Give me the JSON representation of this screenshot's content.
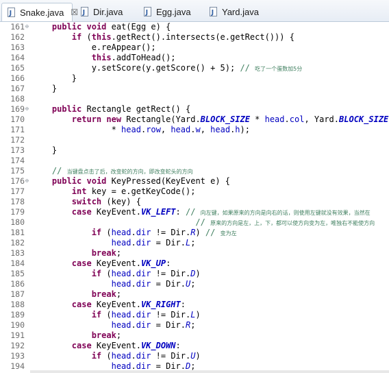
{
  "tabs": [
    {
      "label": "Snake.java",
      "active": true,
      "close": "☒"
    },
    {
      "label": "Dir.java",
      "active": false
    },
    {
      "label": "Egg.java",
      "active": false
    },
    {
      "label": "Yard.java",
      "active": false
    }
  ],
  "colors": {
    "keyword": "#7f0055",
    "comment": "#3f7f5f",
    "field": "#0000c0",
    "line_number": "#6d6d6d"
  },
  "lines": [
    {
      "n": "161",
      "fold": "⊖",
      "tokens": [
        [
          "",
          "    "
        ],
        [
          "kw",
          "public"
        ],
        [
          "",
          " "
        ],
        [
          "kw",
          "void"
        ],
        [
          "",
          " eat(Egg e) {"
        ]
      ]
    },
    {
      "n": "162",
      "tokens": [
        [
          "",
          "        "
        ],
        [
          "kw",
          "if"
        ],
        [
          "",
          " ("
        ],
        [
          "kw",
          "this"
        ],
        [
          "",
          ".getRect().intersects(e.getRect())) {"
        ]
      ]
    },
    {
      "n": "163",
      "tokens": [
        [
          "",
          "            e.reAppear();"
        ]
      ]
    },
    {
      "n": "164",
      "tokens": [
        [
          "",
          "            "
        ],
        [
          "kw",
          "this"
        ],
        [
          "",
          ".addToHead();"
        ]
      ]
    },
    {
      "n": "165",
      "tokens": [
        [
          "",
          "            y.setScore(y.getScore() + 5); "
        ],
        [
          "cm",
          "// "
        ],
        [
          "cms",
          "吃了一个蛋数加5分"
        ]
      ]
    },
    {
      "n": "166",
      "tokens": [
        [
          "",
          "        }"
        ]
      ]
    },
    {
      "n": "167",
      "tokens": [
        [
          "",
          "    }"
        ]
      ]
    },
    {
      "n": "168",
      "tokens": [
        [
          "",
          ""
        ]
      ]
    },
    {
      "n": "169",
      "fold": "⊖",
      "tokens": [
        [
          "",
          "    "
        ],
        [
          "kw",
          "public"
        ],
        [
          "",
          " Rectangle getRect() {"
        ]
      ]
    },
    {
      "n": "170",
      "tokens": [
        [
          "",
          "        "
        ],
        [
          "kw",
          "return"
        ],
        [
          "",
          " "
        ],
        [
          "kw",
          "new"
        ],
        [
          "",
          " Rectangle(Yard."
        ],
        [
          "sfld",
          "BLOCK_SIZE"
        ],
        [
          "",
          " * "
        ],
        [
          "fld",
          "head"
        ],
        [
          "",
          "."
        ],
        [
          "fld",
          "col"
        ],
        [
          "",
          ", Yard."
        ],
        [
          "sfld",
          "BLOCK_SIZE"
        ]
      ]
    },
    {
      "n": "171",
      "tokens": [
        [
          "",
          "                * "
        ],
        [
          "fld",
          "head"
        ],
        [
          "",
          "."
        ],
        [
          "fld",
          "row"
        ],
        [
          "",
          ", "
        ],
        [
          "fld",
          "head"
        ],
        [
          "",
          "."
        ],
        [
          "fld",
          "w"
        ],
        [
          "",
          ", "
        ],
        [
          "fld",
          "head"
        ],
        [
          "",
          "."
        ],
        [
          "fld",
          "h"
        ],
        [
          "",
          ");"
        ]
      ]
    },
    {
      "n": "172",
      "tokens": [
        [
          "",
          ""
        ]
      ]
    },
    {
      "n": "173",
      "tokens": [
        [
          "",
          "    }"
        ]
      ]
    },
    {
      "n": "174",
      "tokens": [
        [
          "",
          ""
        ]
      ]
    },
    {
      "n": "175",
      "tokens": [
        [
          "",
          "    "
        ],
        [
          "cm",
          "// "
        ],
        [
          "cms",
          "当键盘点击了后，改变蛇的方向，即改变蛇头的方向"
        ]
      ]
    },
    {
      "n": "176",
      "fold": "⊖",
      "tokens": [
        [
          "",
          "    "
        ],
        [
          "kw",
          "public"
        ],
        [
          "",
          " "
        ],
        [
          "kw",
          "void"
        ],
        [
          "",
          " KeyPressed(KeyEvent e) {"
        ]
      ]
    },
    {
      "n": "177",
      "tokens": [
        [
          "",
          "        "
        ],
        [
          "kw",
          "int"
        ],
        [
          "",
          " key = e.getKeyCode();"
        ]
      ]
    },
    {
      "n": "178",
      "tokens": [
        [
          "",
          "        "
        ],
        [
          "kw",
          "switch"
        ],
        [
          "",
          " (key) {"
        ]
      ]
    },
    {
      "n": "179",
      "tokens": [
        [
          "",
          "        "
        ],
        [
          "kw",
          "case"
        ],
        [
          "",
          " KeyEvent."
        ],
        [
          "sfld",
          "VK_LEFT"
        ],
        [
          "",
          ": "
        ],
        [
          "cm",
          "// "
        ],
        [
          "cms",
          "向左键，如果原来的方向是向右的话，则使用左键就没有效果，当然在"
        ]
      ]
    },
    {
      "n": "180",
      "tokens": [
        [
          "",
          "                                 "
        ],
        [
          "cm",
          "// "
        ],
        [
          "cms",
          "原来的方向是左，上，下，都可以使方向变为左，唯独右不能使方向"
        ]
      ]
    },
    {
      "n": "181",
      "tokens": [
        [
          "",
          "            "
        ],
        [
          "kw",
          "if"
        ],
        [
          "",
          " ("
        ],
        [
          "fld",
          "head"
        ],
        [
          "",
          "."
        ],
        [
          "fld",
          "dir"
        ],
        [
          "",
          " != Dir."
        ],
        [
          "ifld",
          "R"
        ],
        [
          "",
          ") "
        ],
        [
          "cm",
          "// "
        ],
        [
          "cms",
          "变为左"
        ]
      ]
    },
    {
      "n": "182",
      "tokens": [
        [
          "",
          "                "
        ],
        [
          "fld",
          "head"
        ],
        [
          "",
          "."
        ],
        [
          "fld",
          "dir"
        ],
        [
          "",
          " = Dir."
        ],
        [
          "ifld",
          "L"
        ],
        [
          "",
          ";"
        ]
      ]
    },
    {
      "n": "183",
      "tokens": [
        [
          "",
          "            "
        ],
        [
          "kw",
          "break"
        ],
        [
          "",
          ";"
        ]
      ]
    },
    {
      "n": "184",
      "tokens": [
        [
          "",
          "        "
        ],
        [
          "kw",
          "case"
        ],
        [
          "",
          " KeyEvent."
        ],
        [
          "sfld",
          "VK_UP"
        ],
        [
          "",
          ":"
        ]
      ]
    },
    {
      "n": "185",
      "tokens": [
        [
          "",
          "            "
        ],
        [
          "kw",
          "if"
        ],
        [
          "",
          " ("
        ],
        [
          "fld",
          "head"
        ],
        [
          "",
          "."
        ],
        [
          "fld",
          "dir"
        ],
        [
          "",
          " != Dir."
        ],
        [
          "ifld",
          "D"
        ],
        [
          "",
          ")"
        ]
      ]
    },
    {
      "n": "186",
      "tokens": [
        [
          "",
          "                "
        ],
        [
          "fld",
          "head"
        ],
        [
          "",
          "."
        ],
        [
          "fld",
          "dir"
        ],
        [
          "",
          " = Dir."
        ],
        [
          "ifld",
          "U"
        ],
        [
          "",
          ";"
        ]
      ]
    },
    {
      "n": "187",
      "tokens": [
        [
          "",
          "            "
        ],
        [
          "kw",
          "break"
        ],
        [
          "",
          ";"
        ]
      ]
    },
    {
      "n": "188",
      "tokens": [
        [
          "",
          "        "
        ],
        [
          "kw",
          "case"
        ],
        [
          "",
          " KeyEvent."
        ],
        [
          "sfld",
          "VK_RIGHT"
        ],
        [
          "",
          ":"
        ]
      ]
    },
    {
      "n": "189",
      "tokens": [
        [
          "",
          "            "
        ],
        [
          "kw",
          "if"
        ],
        [
          "",
          " ("
        ],
        [
          "fld",
          "head"
        ],
        [
          "",
          "."
        ],
        [
          "fld",
          "dir"
        ],
        [
          "",
          " != Dir."
        ],
        [
          "ifld",
          "L"
        ],
        [
          "",
          ")"
        ]
      ]
    },
    {
      "n": "190",
      "tokens": [
        [
          "",
          "                "
        ],
        [
          "fld",
          "head"
        ],
        [
          "",
          "."
        ],
        [
          "fld",
          "dir"
        ],
        [
          "",
          " = Dir."
        ],
        [
          "ifld",
          "R"
        ],
        [
          "",
          ";"
        ]
      ]
    },
    {
      "n": "191",
      "tokens": [
        [
          "",
          "            "
        ],
        [
          "kw",
          "break"
        ],
        [
          "",
          ";"
        ]
      ]
    },
    {
      "n": "192",
      "tokens": [
        [
          "",
          "        "
        ],
        [
          "kw",
          "case"
        ],
        [
          "",
          " KeyEvent."
        ],
        [
          "sfld",
          "VK_DOWN"
        ],
        [
          "",
          ":"
        ]
      ]
    },
    {
      "n": "193",
      "tokens": [
        [
          "",
          "            "
        ],
        [
          "kw",
          "if"
        ],
        [
          "",
          " ("
        ],
        [
          "fld",
          "head"
        ],
        [
          "",
          "."
        ],
        [
          "fld",
          "dir"
        ],
        [
          "",
          " != Dir."
        ],
        [
          "ifld",
          "U"
        ],
        [
          "",
          ")"
        ]
      ]
    },
    {
      "n": "194",
      "tokens": [
        [
          "",
          "                "
        ],
        [
          "fld",
          "head"
        ],
        [
          "",
          "."
        ],
        [
          "fld",
          "dir"
        ],
        [
          "",
          " = Dir."
        ],
        [
          "ifld",
          "D"
        ],
        [
          "",
          ";"
        ]
      ]
    }
  ]
}
